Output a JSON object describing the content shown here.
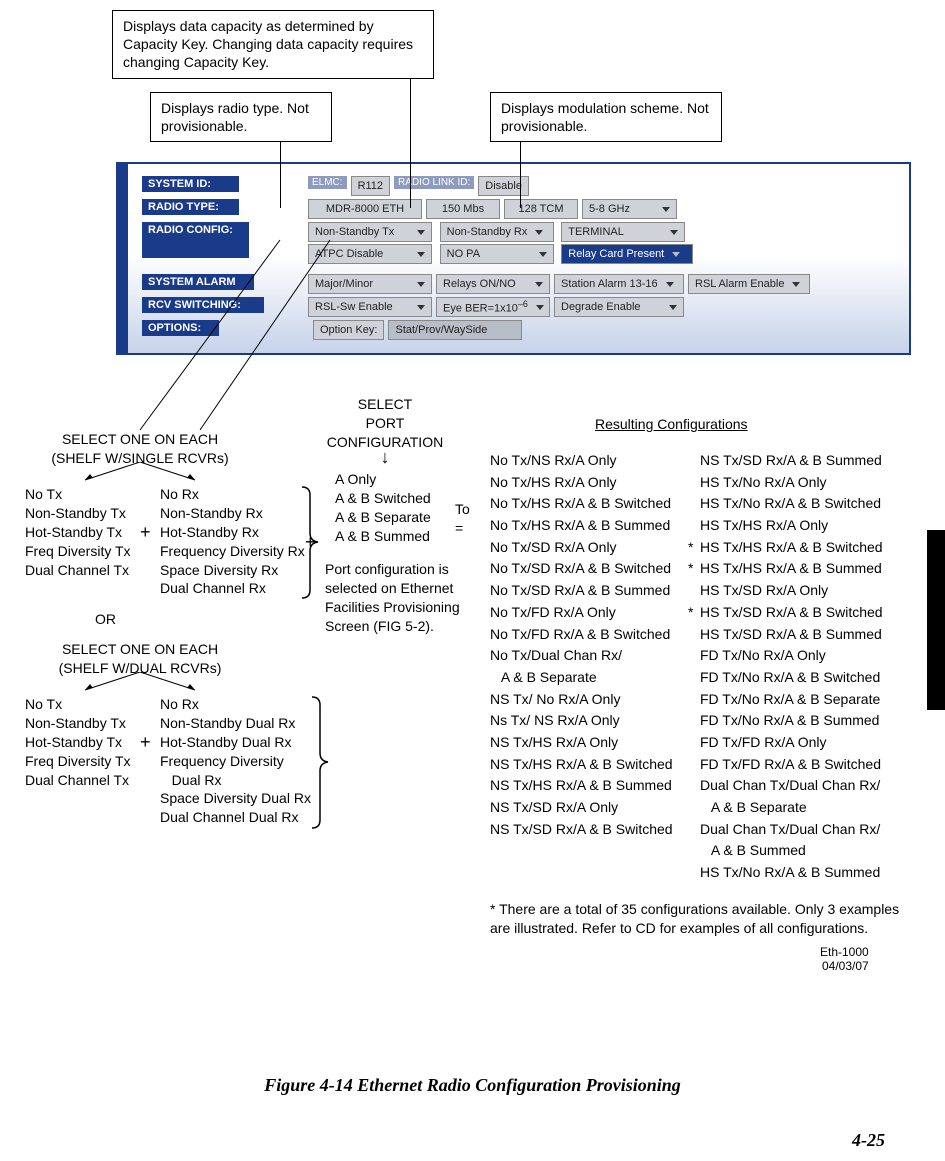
{
  "callouts": {
    "capacity": "Displays data capacity as determined by Capacity Key. Changing data capacity requires changing Capacity Key.",
    "radio_type": "Displays radio type. Not provisionable.",
    "modulation": "Displays modulation scheme. Not provisionable."
  },
  "panel": {
    "system_id": {
      "label": "SYSTEM ID:",
      "elmc": "ELMC:",
      "elmc_val": "R112",
      "rll": "RADIO LINK ID:",
      "rll_val": "Disable"
    },
    "radio_type": {
      "label": "RADIO TYPE:",
      "model": "MDR-8000 ETH",
      "rate": "150 Mbs",
      "tcm": "128 TCM",
      "band": "5-8 GHz"
    },
    "radio_config": {
      "label": "RADIO CONFIG:",
      "tx": "Non-Standby Tx",
      "rx": "Non-Standby Rx",
      "mode": "TERMINAL",
      "atpc": "ATPC Disable",
      "pa": "NO PA",
      "relay": "Relay Card Present"
    },
    "system_alarm": {
      "label": "SYSTEM ALARM",
      "major": "Major/Minor",
      "relays": "Relays ON/NO",
      "station": "Station Alarm 13-16",
      "rsl": "RSL Alarm Enable"
    },
    "rcv_switching": {
      "label": "RCV SWITCHING:",
      "rslsw": "RSL-Sw Enable",
      "eye": "Eye BER=1x10",
      "eyeexp": "–6",
      "degrade": "Degrade Enable"
    },
    "options": {
      "label": "OPTIONS:",
      "optkey": "Option Key:",
      "stat": "Stat/Prov/WaySide"
    }
  },
  "sections": {
    "select_single_hdr1": "SELECT ONE ON EACH",
    "select_single_hdr2": "(SHELF W/SINGLE RCVRs)",
    "select_dual_hdr1": "SELECT ONE ON EACH",
    "select_dual_hdr2": "(SHELF W/DUAL RCVRs)",
    "or": "OR",
    "port_hdr1": "SELECT",
    "port_hdr2": "PORT",
    "port_hdr3": "CONFIGURATION",
    "port_list": [
      "A Only",
      "A & B Switched",
      "A & B Separate",
      "A & B Summed"
    ],
    "port_note": "Port configuration is selected on Ethernet Facilities Provisioning Screen (FIG 5-2).",
    "to": "To",
    "eq": "=",
    "results_hdr": "Resulting Configurations",
    "tx_list": [
      "No Tx",
      "Non-Standby Tx",
      "Hot-Standby Tx",
      "Freq Diversity Tx",
      "Dual Channel Tx"
    ],
    "rx_single_list": [
      "No Rx",
      "Non-Standby Rx",
      "Hot-Standby Rx",
      "Frequency Diversity Rx",
      "Space Diversity Rx",
      "Dual Channel Rx"
    ],
    "rx_dual_list": [
      "No Rx",
      "Non-Standby Dual Rx",
      "Hot-Standby Dual Rx",
      "Frequency Diversity",
      "   Dual Rx",
      "Space Diversity Dual Rx",
      "Dual Channel Dual Rx"
    ],
    "results_col1": [
      "No Tx/NS Rx/A Only",
      "No Tx/HS Rx/A Only",
      "No Tx/HS Rx/A & B Switched",
      "No Tx/HS Rx/A & B Summed",
      "No Tx/SD Rx/A Only",
      "No Tx/SD Rx/A & B Switched",
      "No Tx/SD Rx/A & B Summed",
      "No Tx/FD Rx/A Only",
      "No Tx/FD Rx/A & B Switched",
      "No Tx/Dual Chan Rx/",
      "   A & B Separate",
      "NS Tx/ No Rx/A Only",
      "Ns Tx/ NS Rx/A Only",
      "NS Tx/HS Rx/A Only",
      "NS Tx/HS Rx/A & B Switched",
      "NS Tx/HS Rx/A & B Summed",
      "NS Tx/SD Rx/A Only",
      "NS Tx/SD Rx/A & B Switched"
    ],
    "results_col2": [
      {
        "s": "",
        "t": "NS Tx/SD Rx/A & B Summed"
      },
      {
        "s": "",
        "t": "HS Tx/No Rx/A Only"
      },
      {
        "s": "",
        "t": "HS Tx/No Rx/A & B Switched"
      },
      {
        "s": "",
        "t": "HS Tx/HS Rx/A Only"
      },
      {
        "s": "*",
        "t": "HS Tx/HS Rx/A & B Switched"
      },
      {
        "s": "*",
        "t": "HS Tx/HS Rx/A & B Summed"
      },
      {
        "s": "",
        "t": "HS Tx/SD Rx/A Only"
      },
      {
        "s": "*",
        "t": "HS Tx/SD Rx/A & B Switched"
      },
      {
        "s": "",
        "t": "HS Tx/SD Rx/A & B Summed"
      },
      {
        "s": "",
        "t": "FD Tx/No Rx/A Only"
      },
      {
        "s": "",
        "t": "FD Tx/No Rx/A & B Switched"
      },
      {
        "s": "",
        "t": "FD Tx/No Rx/A & B Separate"
      },
      {
        "s": "",
        "t": "FD Tx/No Rx/A & B Summed"
      },
      {
        "s": "",
        "t": "FD Tx/FD Rx/A Only"
      },
      {
        "s": "",
        "t": "FD Tx/FD Rx/A & B Switched"
      },
      {
        "s": "",
        "t": "Dual Chan Tx/Dual Chan Rx/"
      },
      {
        "s": "",
        "t": "   A & B Separate"
      },
      {
        "s": "",
        "t": "Dual Chan Tx/Dual Chan Rx/"
      },
      {
        "s": "",
        "t": "   A & B Summed"
      },
      {
        "s": "",
        "t": "HS Tx/No Rx/A & B Summed"
      }
    ],
    "footnote": "*  There  are a total of 35 configurations available. Only 3 examples are illustrated. Refer to CD for examples of all configurations.",
    "doc_id": "Eth-1000",
    "doc_date": "04/03/07",
    "fig_caption": "Figure 4-14   Ethernet Radio Configuration Provisioning",
    "page_num": "4-25"
  }
}
